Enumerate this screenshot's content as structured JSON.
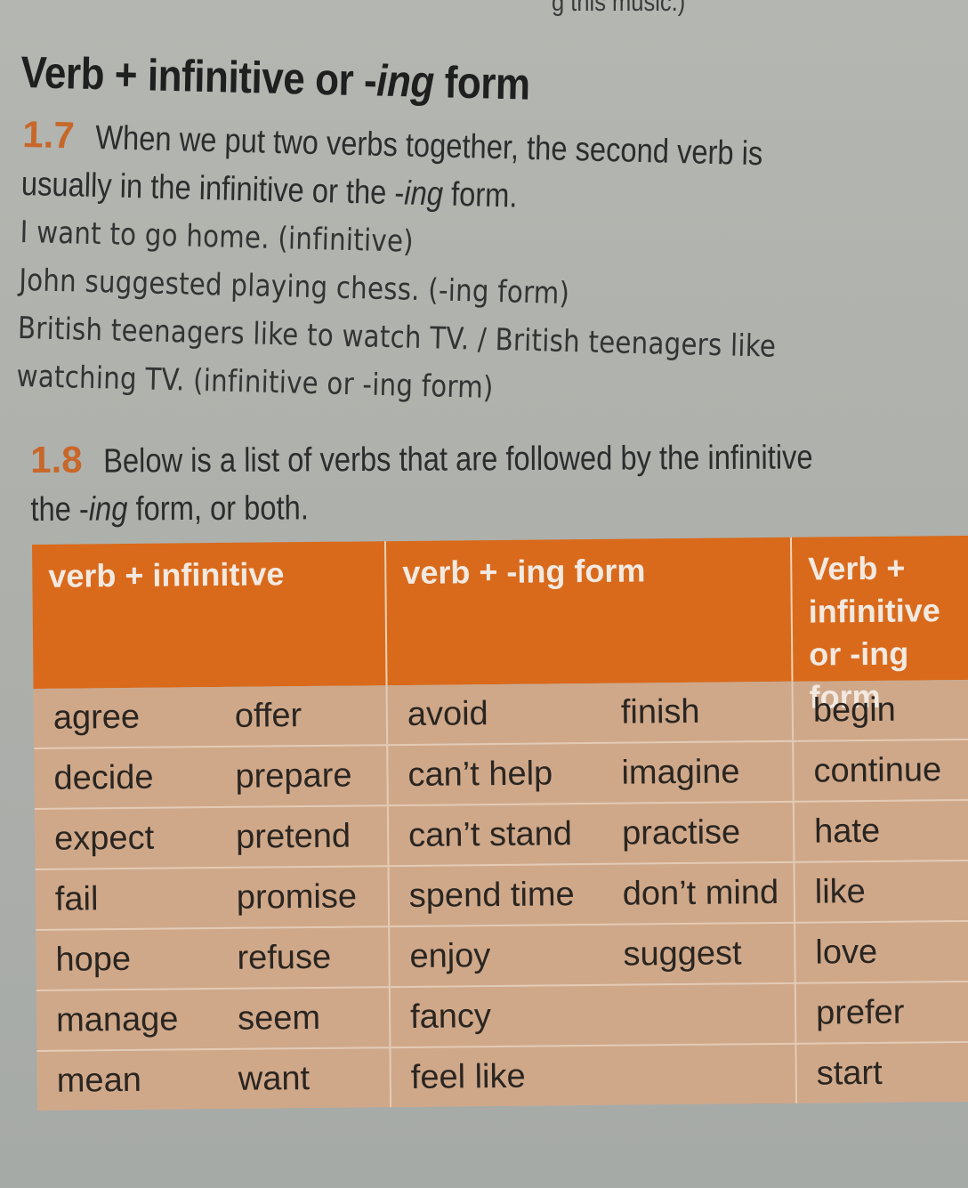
{
  "page_top_fragment": "g this music.)",
  "title": {
    "prefix": "Verb + infinitive or -",
    "italic": "ing",
    "suffix": " form"
  },
  "section_1_7": {
    "number": "1.7",
    "line1": "When we put two verbs together, the second verb is",
    "line2_prefix": "usually in the infinitive or the -",
    "line2_italic": "ing",
    "line2_suffix": " form.",
    "examples": [
      {
        "text": "I want to go home. (infinitive)"
      },
      {
        "text": "John suggested playing chess. (-ing form)"
      },
      {
        "text": "British teenagers like to watch TV. / British teenagers like"
      },
      {
        "text": "watching TV. (infinitive or -ing form)"
      }
    ]
  },
  "section_1_8": {
    "number": "1.8",
    "line1": "Below is a list of verbs that are followed by the infinitive",
    "line2_prefix": "the -",
    "line2_italic": "ing",
    "line2_suffix": " form, or both."
  },
  "table": {
    "headers": [
      "verb + infinitive",
      "verb + -ing form",
      "Verb + infinitive or -ing form"
    ],
    "rows": [
      [
        "agree",
        "offer",
        "avoid",
        "finish",
        "begin"
      ],
      [
        "decide",
        "prepare",
        "can’t help",
        "imagine",
        "continue"
      ],
      [
        "expect",
        "pretend",
        "can’t stand",
        "practise",
        "hate"
      ],
      [
        "fail",
        "promise",
        "spend time",
        "don’t mind",
        "like"
      ],
      [
        "hope",
        "refuse",
        "enjoy",
        "suggest",
        "love"
      ],
      [
        "manage",
        "seem",
        "fancy",
        "",
        "prefer"
      ],
      [
        "mean",
        "want",
        "feel like",
        "",
        "start"
      ]
    ]
  },
  "colors": {
    "accent_orange": "#d96a1c",
    "section_number": "#c7672a",
    "table_body": "#cfa88a",
    "header_text": "#f2e9e1"
  }
}
